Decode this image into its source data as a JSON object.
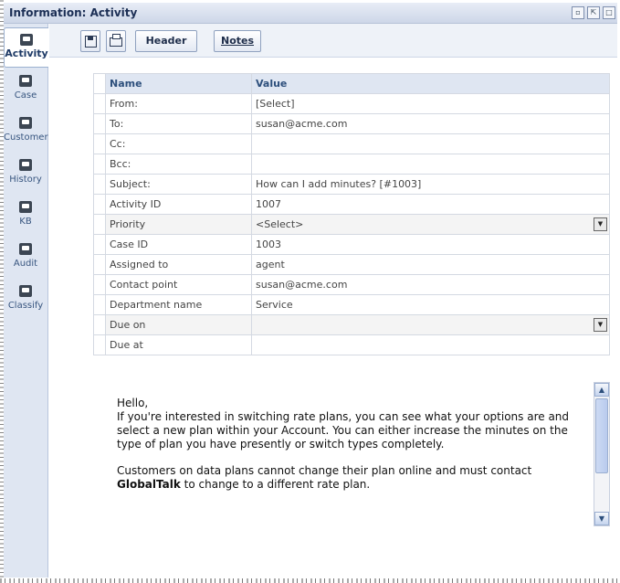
{
  "window": {
    "title": "Information: Activity"
  },
  "nav": [
    {
      "label": "Activity",
      "icon": "activity-icon",
      "active": true
    },
    {
      "label": "Case",
      "icon": "case-icon"
    },
    {
      "label": "Customer",
      "icon": "customer-icon"
    },
    {
      "label": "History",
      "icon": "history-icon"
    },
    {
      "label": "KB",
      "icon": "kb-icon"
    },
    {
      "label": "Audit",
      "icon": "audit-icon"
    },
    {
      "label": "Classify",
      "icon": "classify-icon"
    }
  ],
  "toolbar": {
    "save_icon": "save-icon",
    "print_icon": "print-icon",
    "header_label": "Header",
    "notes_label": "Notes"
  },
  "table": {
    "columns": [
      "Name",
      "Value"
    ],
    "rows": [
      {
        "name": "From:",
        "value": "[Select]"
      },
      {
        "name": "To:",
        "value": "susan@acme.com"
      },
      {
        "name": "Cc:",
        "value": ""
      },
      {
        "name": "Bcc:",
        "value": ""
      },
      {
        "name": "Subject:",
        "value": "How can I add minutes? [#1003]"
      },
      {
        "name": "Activity ID",
        "value": "1007"
      },
      {
        "name": "Priority",
        "value": "<Select>",
        "dropdown": true
      },
      {
        "name": "Case ID",
        "value": "1003"
      },
      {
        "name": "Assigned to",
        "value": "agent"
      },
      {
        "name": "Contact point",
        "value": "susan@acme.com"
      },
      {
        "name": "Department name",
        "value": "Service"
      },
      {
        "name": "Due on",
        "value": "",
        "dropdown": true
      },
      {
        "name": "Due at",
        "value": ""
      }
    ]
  },
  "message": {
    "greeting": "Hello,",
    "para1": "If you're interested in switching rate plans, you can see what your options are and select a new plan within your Account. You can either increase the minutes on the type of plan you have presently or switch types completely.",
    "para2_before": "Customers on data plans cannot change their plan online and must contact ",
    "para2_bold": "GlobalTalk",
    "para2_after": " to change to a different rate plan."
  }
}
